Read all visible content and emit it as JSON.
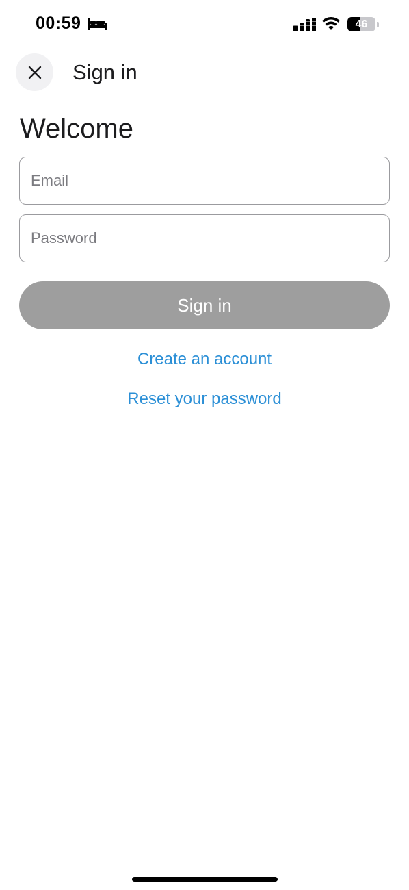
{
  "status_bar": {
    "time": "00:59",
    "battery_level": 46,
    "battery_text": "46",
    "icons": [
      "bed-icon",
      "cellular-signal-icon",
      "wifi-icon",
      "battery-icon"
    ]
  },
  "header": {
    "close_icon": "close-icon",
    "title": "Sign in"
  },
  "form": {
    "heading": "Welcome",
    "email": {
      "placeholder": "Email",
      "value": ""
    },
    "password": {
      "placeholder": "Password",
      "value": ""
    },
    "submit_label": "Sign in",
    "create_account_label": "Create an account",
    "reset_password_label": "Reset your password"
  },
  "colors": {
    "link": "#2b8fd6",
    "button_disabled": "#9e9e9e",
    "field_border": "#9b9b9f"
  }
}
